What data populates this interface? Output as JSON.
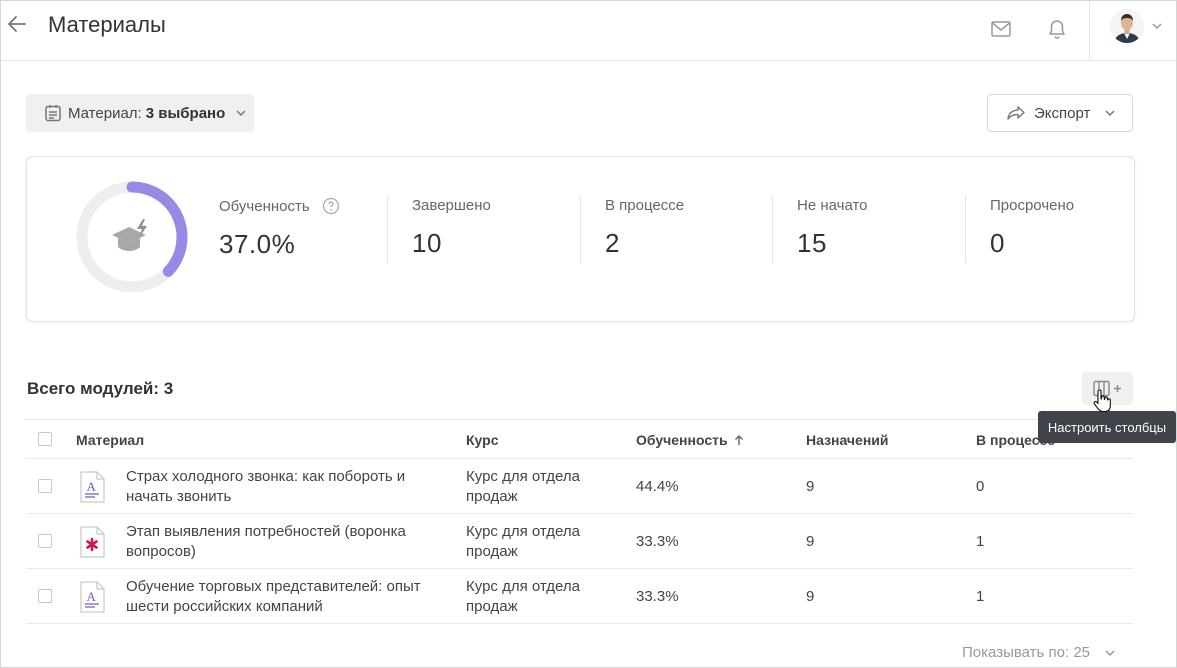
{
  "header": {
    "title": "Материалы",
    "back_icon": "arrow-left-icon",
    "mail_icon": "mail-icon",
    "bell_icon": "bell-icon",
    "avatar": "user-avatar"
  },
  "filter": {
    "label": "Материал:",
    "value": "3 выбрано",
    "icon": "calendar-icon"
  },
  "export": {
    "label": "Экспорт",
    "icon": "share-icon"
  },
  "stats": {
    "progress_fraction": 0.37,
    "progress_color": "#9b87e6",
    "items": [
      {
        "label": "Обученность",
        "value": "37.0%"
      },
      {
        "label": "Завершено",
        "value": "10"
      },
      {
        "label": "В процессе",
        "value": "2"
      },
      {
        "label": "Не начато",
        "value": "15"
      },
      {
        "label": "Просрочено",
        "value": "0"
      }
    ]
  },
  "modules": {
    "total_label": "Всего модулей: 3",
    "columns_tooltip": "Настроить столбцы",
    "columns": {
      "material": "Материал",
      "course": "Курс",
      "progress": "Обученность",
      "assignments": "Назначений",
      "in_progress": "В процессе"
    },
    "rows": [
      {
        "title": "Страх холодного звонка: как побороть и начать звонить",
        "course": "Курс для отдела продаж",
        "progress": "44.4%",
        "assignments": "9",
        "in_progress": "0",
        "icon": "text-document-icon"
      },
      {
        "title": "Этап выявления потребностей (воронка вопросов)",
        "course": "Курс для отдела продаж",
        "progress": "33.3%",
        "assignments": "9",
        "in_progress": "1",
        "icon": "presentation-document-icon"
      },
      {
        "title": "Обучение торговых представителей: опыт шести российских компаний",
        "course": "Курс для отдела продаж",
        "progress": "33.3%",
        "assignments": "9",
        "in_progress": "1",
        "icon": "text-document-icon"
      }
    ]
  },
  "pagination": {
    "label": "Показывать по: 25"
  },
  "colors": {
    "accent": "#9b87e6",
    "doc_accent": "#7a57c8",
    "pinwheel": "#d4145a"
  }
}
